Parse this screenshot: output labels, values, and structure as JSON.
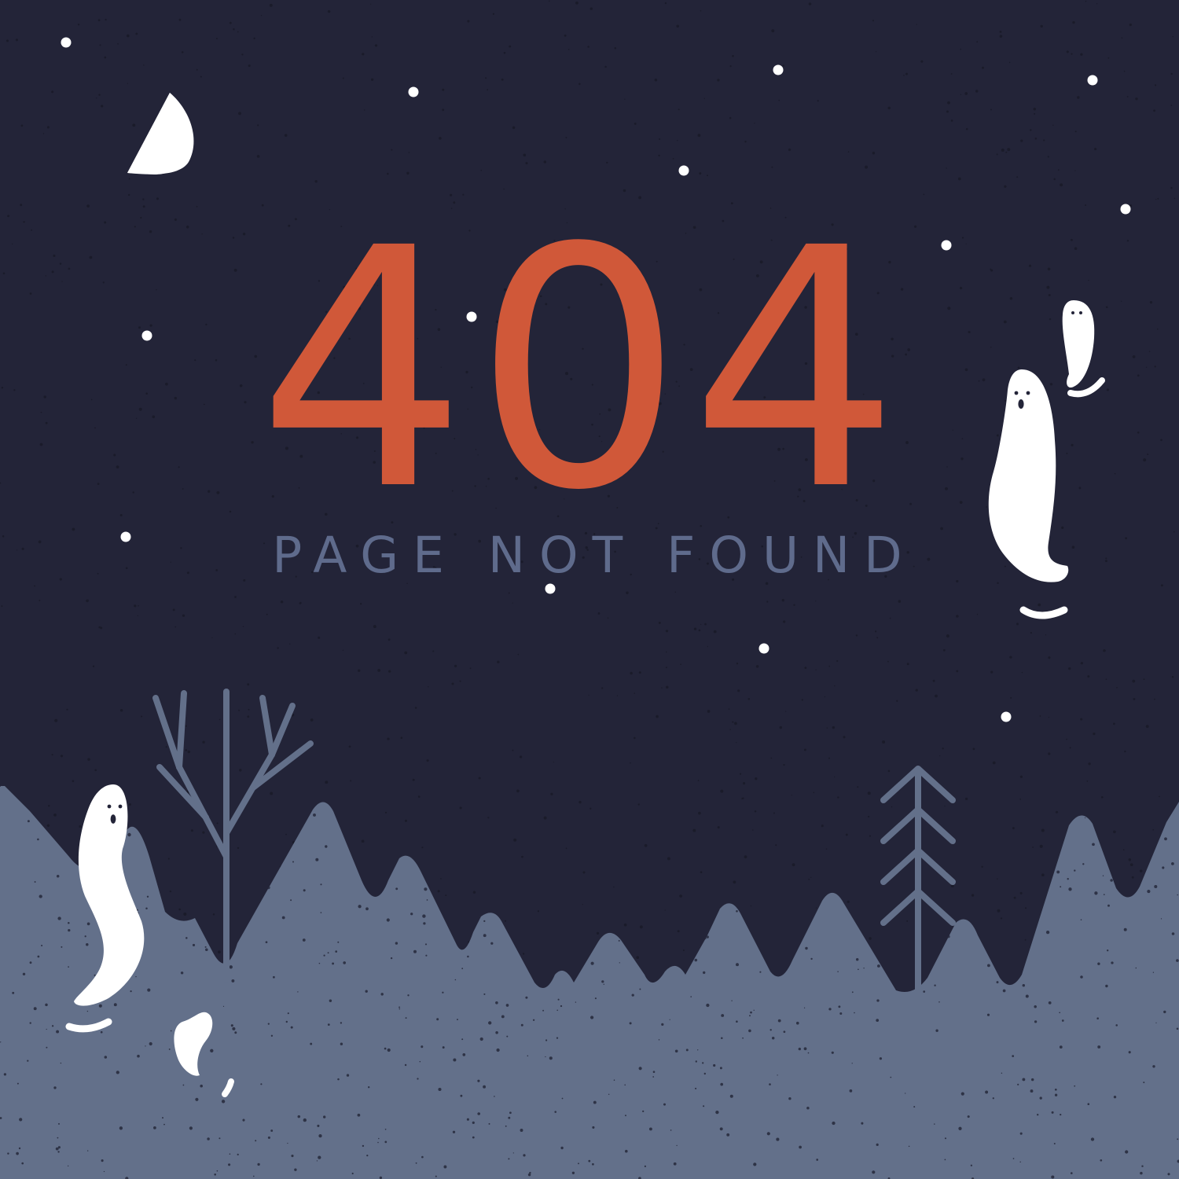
{
  "error": {
    "code": "404",
    "message": "PAGE NOT FOUND"
  },
  "colors": {
    "sky": "#232438",
    "ground": "#63708a",
    "accent": "#d45a3a",
    "message_text": "#5f6b8c",
    "tree_stroke": "#63708a",
    "ghost": "#ffffff",
    "moon": "#ffffff",
    "star": "#ffffff"
  },
  "illustration": {
    "moon_icon": "half-moon",
    "ghost_icon": "ghost",
    "bare_tree_icon": "bare-tree",
    "pine_tree_icon": "pine-tree",
    "star_icon": "dot"
  }
}
